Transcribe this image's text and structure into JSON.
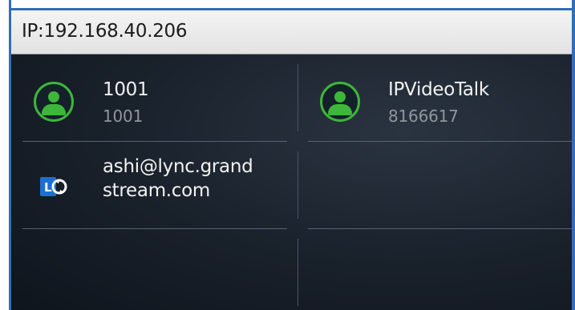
{
  "title_bar": {
    "ip_label": "IP:192.168.40.206"
  },
  "contacts": [
    {
      "name": "1001",
      "number": "1001",
      "icon": "person-avatar-icon",
      "status_color": "#3db63a"
    },
    {
      "name": "IPVideoTalk",
      "number": "8166617",
      "icon": "person-avatar-icon",
      "status_color": "#3db63a"
    },
    {
      "name": "ashi@lync.grand stream.com",
      "icon": "lync-icon",
      "icon_color": "#1f6fd1"
    }
  ],
  "colors": {
    "border_blue": "#2f6fb6",
    "panel_bg": "#18202a",
    "presence_green": "#3db63a"
  }
}
